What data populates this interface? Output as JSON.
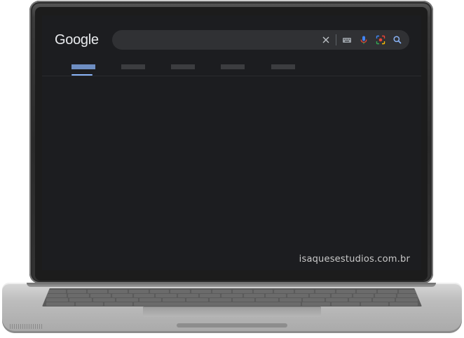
{
  "google": {
    "logo_text": "Google",
    "search": {
      "value": "",
      "icons": [
        "close-icon",
        "keyboard-icon",
        "microphone-icon",
        "lens-camera-icon",
        "search-icon"
      ]
    },
    "tabs_count_note": ""
  },
  "watermark": "isaquesestudios.com.br",
  "colors": {
    "screen_bg": "#1c1d20",
    "searchbox_bg": "#303134",
    "accent_blue": "#8ab4f8",
    "mic_red": "#ea4335",
    "google_yellow": "#fbbc04"
  }
}
